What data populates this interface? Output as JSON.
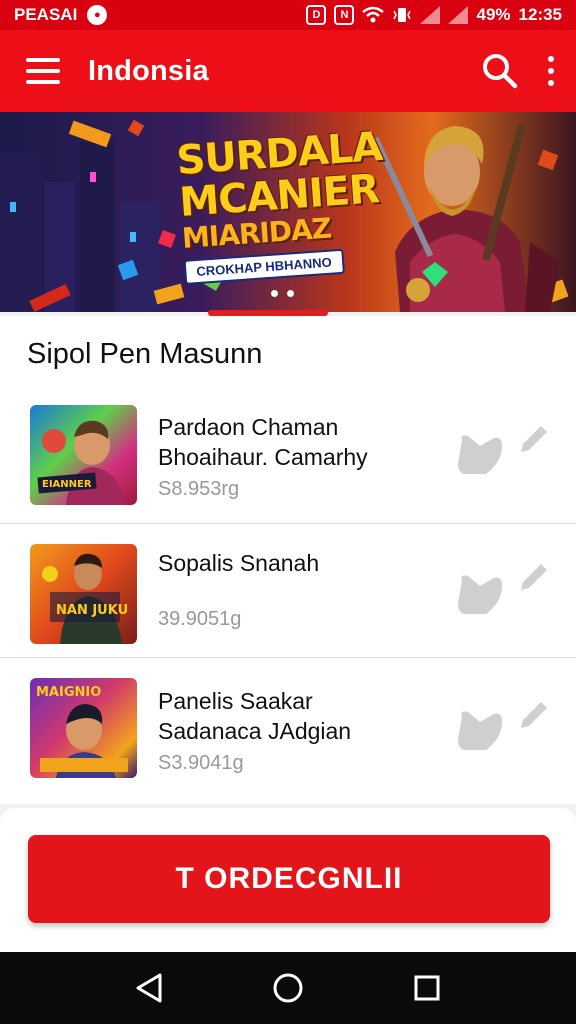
{
  "status_bar": {
    "carrier": "PEASAI",
    "battery": "49%",
    "time": "12:35"
  },
  "app_bar": {
    "title": "Indonsia",
    "menu_icon": "hamburger-menu-icon",
    "search_icon": "search-icon",
    "more_icon": "more-vertical-icon"
  },
  "banner": {
    "line1": "SURDALA",
    "line2": "MCANIER",
    "line3": "MIARIDAZ",
    "ribbon": "CROKHAP HBHANNO",
    "slide_count": 2
  },
  "section": {
    "title": "Sipol Pen Masunn"
  },
  "items": [
    {
      "name_line1": "Pardaon Chaman",
      "name_line2": "Bhoaihaur. Camarhy",
      "price": "S8.953rg",
      "thumb_caption": "EIANNER"
    },
    {
      "name_line1": "Sopalis Snanah",
      "name_line2": "",
      "price": "39.9051g",
      "thumb_caption": "NAN JUKU"
    },
    {
      "name_line1": "Panelis Saakar",
      "name_line2": "Sadanaca JAdgian",
      "price": "S3.9041g",
      "thumb_caption": "MAIGNIO"
    }
  ],
  "cta": {
    "label": "T ORDECGNLII"
  },
  "colors": {
    "primary": "#ec0f17",
    "status_bar": "#d9000f",
    "button": "#e4141b",
    "icon_grey": "#cfcfcf"
  }
}
